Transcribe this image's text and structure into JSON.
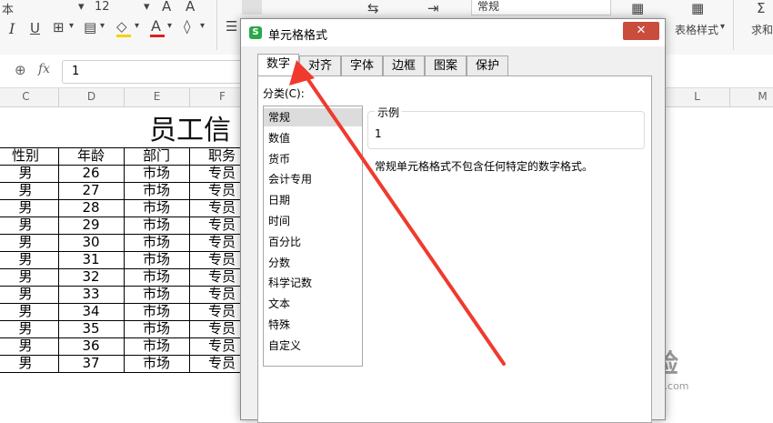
{
  "ribbon": {
    "left_label": "本",
    "font_size": "12",
    "font_grow": "A",
    "font_shrink": "A",
    "italic": "I",
    "underline": "U",
    "number_format": "常规",
    "table_style_label": "表格样式",
    "sum_label": "求和"
  },
  "formula_bar": {
    "fx_label": "fx",
    "value": "1"
  },
  "columns": [
    "C",
    "D",
    "E",
    "F",
    "L",
    "M"
  ],
  "sheet": {
    "title": "员工信",
    "headers": [
      "性别",
      "年龄",
      "部门",
      "职务"
    ],
    "rows": [
      [
        "男",
        "26",
        "市场",
        "专员"
      ],
      [
        "男",
        "27",
        "市场",
        "专员"
      ],
      [
        "男",
        "28",
        "市场",
        "专员"
      ],
      [
        "男",
        "29",
        "市场",
        "专员"
      ],
      [
        "男",
        "30",
        "市场",
        "专员"
      ],
      [
        "男",
        "31",
        "市场",
        "专员"
      ],
      [
        "男",
        "32",
        "市场",
        "专员"
      ],
      [
        "男",
        "33",
        "市场",
        "专员"
      ],
      [
        "男",
        "34",
        "市场",
        "专员"
      ],
      [
        "男",
        "35",
        "市场",
        "专员"
      ],
      [
        "男",
        "36",
        "市场",
        "专员"
      ],
      [
        "男",
        "37",
        "市场",
        "专员"
      ]
    ]
  },
  "dialog": {
    "title": "单元格格式",
    "app_icon": "S",
    "close": "✕",
    "tabs": [
      "数字",
      "对齐",
      "字体",
      "边框",
      "图案",
      "保护"
    ],
    "active_tab": 0,
    "category_label": "分类(C):",
    "categories": [
      "常规",
      "数值",
      "货币",
      "会计专用",
      "日期",
      "时间",
      "百分比",
      "分数",
      "科学记数",
      "文本",
      "特殊",
      "自定义"
    ],
    "selected_category": 0,
    "sample_label": "示例",
    "sample_value": "1",
    "description": "常规单元格格式不包含任何特定的数字格式。"
  },
  "annotation": {
    "color": "#f03a2e"
  },
  "watermark": {
    "brand": "Bai经验",
    "url": "jingyan.baidu.com"
  }
}
